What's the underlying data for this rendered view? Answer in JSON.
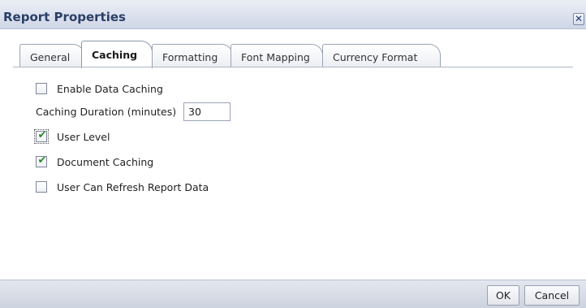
{
  "dialog": {
    "title": "Report Properties",
    "close_glyph": "✕"
  },
  "tabs": [
    {
      "label": "General",
      "active": false
    },
    {
      "label": "Caching",
      "active": true
    },
    {
      "label": "Formatting",
      "active": false
    },
    {
      "label": "Font Mapping",
      "active": false
    },
    {
      "label": "Currency Format",
      "active": false
    }
  ],
  "caching": {
    "enable_data_caching": {
      "label": "Enable Data Caching",
      "checked": false
    },
    "duration": {
      "label": "Caching Duration (minutes)",
      "value": "30"
    },
    "user_level": {
      "label": "User Level",
      "checked": true
    },
    "document_caching": {
      "label": "Document Caching",
      "checked": true
    },
    "user_can_refresh": {
      "label": "User Can Refresh Report Data",
      "checked": false
    }
  },
  "footer": {
    "ok_label": "OK",
    "cancel_label": "Cancel"
  },
  "icons": {
    "close": "close-icon",
    "check": "checkmark-icon"
  },
  "colors": {
    "title_text": "#2b3f66",
    "check_green": "#2a8a2a",
    "header_bg": "#cfd6e6"
  }
}
